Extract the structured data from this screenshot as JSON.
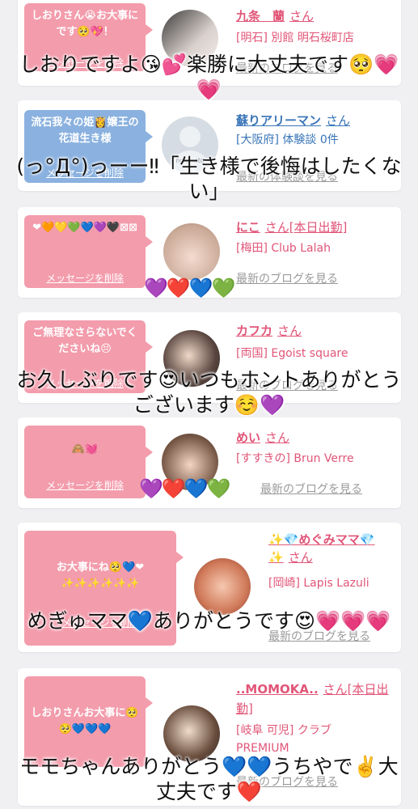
{
  "cards": [
    {
      "bubble": "しおりさん😭お大事にです🥺💖！",
      "delete_label": "メッセージを削除",
      "name": "九条　蘭",
      "honorific": "さん",
      "area_shop": "[明石] 別館 明石桜町店",
      "blog_label": "最新のブログを見る"
    },
    {
      "bubble": "流石我々の姫👸嬢王の花道生き様",
      "delete_label": "メッセージを削除",
      "name": "蘇りアリーマン",
      "honorific": "さん",
      "area_shop": "[大阪府] 体験談 0件",
      "blog_label": "最新の体験談を見る",
      "avatar_text": "no photo"
    },
    {
      "bubble": "❤🧡💛💚💙💜🖤⊠⊠",
      "delete_label": "メッセージを削除",
      "name": "にこ",
      "honorific": "さん[本日出勤]",
      "area_shop": "[梅田] Club Lalah",
      "blog_label": "最新のブログを見る"
    },
    {
      "bubble": "ご無理なさらないでくださいね😣",
      "delete_label": "メッセージを削除",
      "name": "カフカ",
      "honorific": "さん",
      "area_shop": "[両国] Egoist square",
      "blog_label": "最新のブログを見る"
    },
    {
      "bubble": "🙈💓",
      "delete_label": "メッセージを削除",
      "name": "めい",
      "honorific": "さん",
      "area_shop": "[すすきの] Brun Verre",
      "blog_label": "最新のブログを見る"
    },
    {
      "bubble": "お大事にね🥺💙❤✨✨✨✨✨✨",
      "delete_label": "メッセージを削除",
      "name": "✨💎めぐみママ💎✨",
      "honorific": "さん",
      "area_shop": "[岡崎] Lapis Lazuli",
      "blog_label": "最新のブログを見る"
    },
    {
      "bubble": "しおりさんお大事に🥺🥺💙💙💙",
      "delete_label": "メッセージを削除",
      "name": "..MOMOKA..",
      "honorific": "さん[本日出勤]",
      "area_shop": "[岐阜 可児] クラブPREMIUM",
      "blog_label": "最新のブログを見る"
    }
  ],
  "captions": [
    "しおりですよ😘💕楽勝に大丈夫です🥺💗💗",
    "(っ°Д°)っーー‼︎「生き様で後悔はしたくない」",
    "お久しぶりです😍いつもホントありがとうございます☺️💜",
    "めぎゅママ💙ありがとうです😍💗💗💗",
    "モモちゃんありがとう💙💙うちやで✌️大丈夫です❤️"
  ],
  "hearts_rows": [
    "💜❤️💙💚",
    "💜❤️💙💚"
  ],
  "colors": {
    "page_bg": "#f0eff2",
    "bubble_pink": "#f39cac",
    "bubble_blue": "#8ab1df",
    "name_pink": "#e15577",
    "name_blue": "#3975b8"
  }
}
